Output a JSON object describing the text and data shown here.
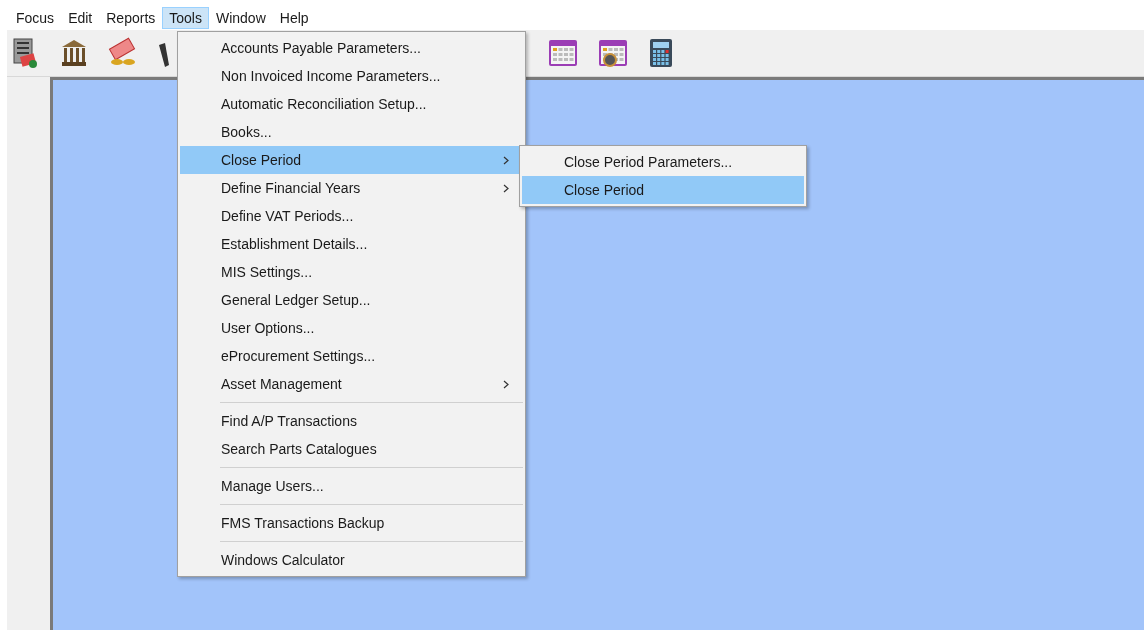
{
  "menubar": [
    {
      "label": "Focus",
      "selected": false
    },
    {
      "label": "Edit",
      "selected": false
    },
    {
      "label": "Reports",
      "selected": false
    },
    {
      "label": "Tools",
      "selected": true
    },
    {
      "label": "Window",
      "selected": false
    },
    {
      "label": "Help",
      "selected": false
    }
  ],
  "tools_menu": [
    {
      "kind": "item",
      "label": "Accounts Payable Parameters...",
      "submenu": false,
      "selected": false
    },
    {
      "kind": "item",
      "label": "Non Invoiced Income Parameters...",
      "submenu": false,
      "selected": false
    },
    {
      "kind": "item",
      "label": "Automatic Reconciliation Setup...",
      "submenu": false,
      "selected": false
    },
    {
      "kind": "item",
      "label": "Books...",
      "submenu": false,
      "selected": false
    },
    {
      "kind": "item",
      "label": "Close Period",
      "submenu": true,
      "selected": true
    },
    {
      "kind": "item",
      "label": "Define Financial Years",
      "submenu": true,
      "selected": false
    },
    {
      "kind": "item",
      "label": "Define VAT Periods...",
      "submenu": false,
      "selected": false
    },
    {
      "kind": "item",
      "label": "Establishment Details...",
      "submenu": false,
      "selected": false
    },
    {
      "kind": "item",
      "label": "MIS Settings...",
      "submenu": false,
      "selected": false
    },
    {
      "kind": "item",
      "label": "General Ledger Setup...",
      "submenu": false,
      "selected": false
    },
    {
      "kind": "item",
      "label": "User Options...",
      "submenu": false,
      "selected": false
    },
    {
      "kind": "item",
      "label": "eProcurement Settings...",
      "submenu": false,
      "selected": false
    },
    {
      "kind": "item",
      "label": "Asset Management",
      "submenu": true,
      "selected": false
    },
    {
      "kind": "separator"
    },
    {
      "kind": "item",
      "label": "Find A/P Transactions",
      "submenu": false,
      "selected": false
    },
    {
      "kind": "item",
      "label": "Search Parts Catalogues",
      "submenu": false,
      "selected": false
    },
    {
      "kind": "separator"
    },
    {
      "kind": "item",
      "label": "Manage Users...",
      "submenu": false,
      "selected": false
    },
    {
      "kind": "separator"
    },
    {
      "kind": "item",
      "label": "FMS Transactions Backup",
      "submenu": false,
      "selected": false
    },
    {
      "kind": "separator"
    },
    {
      "kind": "item",
      "label": "Windows Calculator",
      "submenu": false,
      "selected": false
    }
  ],
  "close_period_submenu": [
    {
      "label": "Close Period Parameters...",
      "selected": false
    },
    {
      "label": "Close Period",
      "selected": true
    }
  ]
}
